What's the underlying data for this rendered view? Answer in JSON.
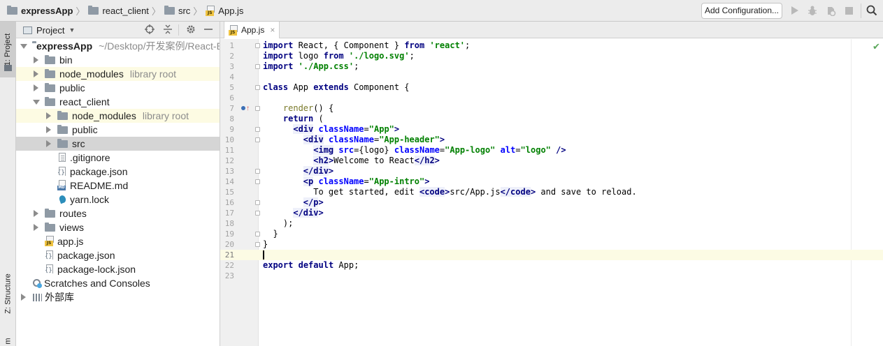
{
  "breadcrumbs": [
    {
      "label": "expressApp",
      "icon": "folder-icon"
    },
    {
      "label": "react_client",
      "icon": "folder-icon"
    },
    {
      "label": "src",
      "icon": "folder-icon"
    },
    {
      "label": "App.js",
      "icon": "js-file-icon"
    }
  ],
  "toolbar": {
    "add_config_label": "Add Configuration...",
    "icons": [
      "run-icon",
      "debug-icon",
      "coverage-icon",
      "stop-icon",
      "search-icon"
    ]
  },
  "left_stripe": {
    "project_tab": "1: Project",
    "structure_tab": "Z: Structure",
    "bottom_tab": "m"
  },
  "project_panel": {
    "title": "Project",
    "icons": [
      "locate-icon",
      "collapse-icon",
      "settings-icon",
      "hide-icon"
    ],
    "tree": [
      {
        "name": "expressApp",
        "hint": "~/Desktop/开发案例/React-E",
        "depth": 0,
        "arrow": "down",
        "icon": "folder",
        "bold": true
      },
      {
        "name": "bin",
        "depth": 1,
        "arrow": "right",
        "icon": "folder"
      },
      {
        "name": "node_modules",
        "hint": "library root",
        "depth": 1,
        "arrow": "right",
        "icon": "folder",
        "lib": true
      },
      {
        "name": "public",
        "depth": 1,
        "arrow": "right",
        "icon": "folder"
      },
      {
        "name": "react_client",
        "depth": 1,
        "arrow": "down",
        "icon": "folder"
      },
      {
        "name": "node_modules",
        "hint": "library root",
        "depth": 2,
        "arrow": "right",
        "icon": "folder",
        "lib": true
      },
      {
        "name": "public",
        "depth": 2,
        "arrow": "right",
        "icon": "folder"
      },
      {
        "name": "src",
        "depth": 2,
        "arrow": "right",
        "icon": "folder",
        "selected": true
      },
      {
        "name": ".gitignore",
        "depth": 2,
        "arrow": "none",
        "icon": "txt"
      },
      {
        "name": "package.json",
        "depth": 2,
        "arrow": "none",
        "icon": "json"
      },
      {
        "name": "README.md",
        "depth": 2,
        "arrow": "none",
        "icon": "md"
      },
      {
        "name": "yarn.lock",
        "depth": 2,
        "arrow": "none",
        "icon": "yarn"
      },
      {
        "name": "routes",
        "depth": 1,
        "arrow": "right",
        "icon": "folder"
      },
      {
        "name": "views",
        "depth": 1,
        "arrow": "right",
        "icon": "folder"
      },
      {
        "name": "app.js",
        "depth": 1,
        "arrow": "none",
        "icon": "jsf"
      },
      {
        "name": "package.json",
        "depth": 1,
        "arrow": "none",
        "icon": "json"
      },
      {
        "name": "package-lock.json",
        "depth": 1,
        "arrow": "none",
        "icon": "json"
      },
      {
        "name": "Scratches and Consoles",
        "depth": 0,
        "arrow": "none-root",
        "icon": "scr"
      },
      {
        "name": "外部库",
        "depth": 0,
        "arrow": "right",
        "icon": "lib"
      }
    ]
  },
  "editor": {
    "tab_label": "App.js",
    "tab_close": "×",
    "status_icon": "check-icon",
    "current_line": 21,
    "lines": [
      "import React, { Component } from 'react';",
      "import logo from './logo.svg';",
      "import './App.css';",
      "",
      "class App extends Component {",
      "",
      "    render() {",
      "    return (",
      "      <div className=\"App\">",
      "        <div className=\"App-header\">",
      "          <img src={logo} className=\"App-logo\" alt=\"logo\" />",
      "          <h2>Welcome to React</h2>",
      "        </div>",
      "        <p className=\"App-intro\">",
      "          To get started, edit <code>src/App.js</code> and save to reload.",
      "        </p>",
      "      </div>",
      "    );",
      "  }",
      "}",
      "",
      "export default App;",
      ""
    ]
  }
}
